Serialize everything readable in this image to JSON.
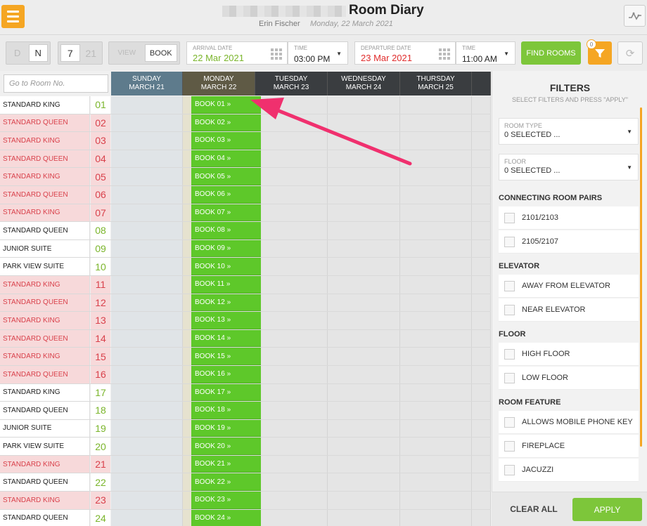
{
  "header": {
    "title": "Room Diary",
    "user": "Erin Fischer",
    "date": "Monday, 22 March 2021"
  },
  "toolbar": {
    "day_toggle": [
      "D",
      "N"
    ],
    "num_toggle": [
      "7",
      "21"
    ],
    "mode_toggle": [
      "VIEW",
      "BOOK"
    ],
    "arrival_label": "ARRIVAL DATE",
    "arrival_value": "22 Mar 2021",
    "arrival_time_label": "TIME",
    "arrival_time": "03:00 PM",
    "departure_label": "DEPARTURE DATE",
    "departure_value": "23 Mar 2021",
    "departure_time_label": "TIME",
    "departure_time": "11:00 AM",
    "find_rooms": "FIND ROOMS",
    "filter_badge": "0"
  },
  "grid": {
    "search_placeholder": "Go to Room No.",
    "days": [
      {
        "dow": "SUNDAY",
        "date": "MARCH 21"
      },
      {
        "dow": "MONDAY",
        "date": "MARCH 22"
      },
      {
        "dow": "TUESDAY",
        "date": "MARCH 23"
      },
      {
        "dow": "WEDNESDAY",
        "date": "MARCH 24"
      },
      {
        "dow": "THURSDAY",
        "date": "MARCH 25"
      }
    ],
    "rooms": [
      {
        "type": "STANDARD KING",
        "num": "01",
        "book": "BOOK 01 »",
        "dirty": false
      },
      {
        "type": "STANDARD QUEEN",
        "num": "02",
        "book": "BOOK 02 »",
        "dirty": true
      },
      {
        "type": "STANDARD KING",
        "num": "03",
        "book": "BOOK 03 »",
        "dirty": true
      },
      {
        "type": "STANDARD QUEEN",
        "num": "04",
        "book": "BOOK 04 »",
        "dirty": true
      },
      {
        "type": "STANDARD KING",
        "num": "05",
        "book": "BOOK 05 »",
        "dirty": true
      },
      {
        "type": "STANDARD QUEEN",
        "num": "06",
        "book": "BOOK 06 »",
        "dirty": true
      },
      {
        "type": "STANDARD KING",
        "num": "07",
        "book": "BOOK 07 »",
        "dirty": true
      },
      {
        "type": "STANDARD QUEEN",
        "num": "08",
        "book": "BOOK 08 »",
        "dirty": false
      },
      {
        "type": "JUNIOR SUITE",
        "num": "09",
        "book": "BOOK 09 »",
        "dirty": false
      },
      {
        "type": "PARK VIEW SUITE",
        "num": "10",
        "book": "BOOK 10 »",
        "dirty": false
      },
      {
        "type": "STANDARD KING",
        "num": "11",
        "book": "BOOK 11 »",
        "dirty": true
      },
      {
        "type": "STANDARD QUEEN",
        "num": "12",
        "book": "BOOK 12 »",
        "dirty": true
      },
      {
        "type": "STANDARD KING",
        "num": "13",
        "book": "BOOK 13 »",
        "dirty": true
      },
      {
        "type": "STANDARD QUEEN",
        "num": "14",
        "book": "BOOK 14 »",
        "dirty": true
      },
      {
        "type": "STANDARD KING",
        "num": "15",
        "book": "BOOK 15 »",
        "dirty": true
      },
      {
        "type": "STANDARD QUEEN",
        "num": "16",
        "book": "BOOK 16 »",
        "dirty": true
      },
      {
        "type": "STANDARD KING",
        "num": "17",
        "book": "BOOK 17 »",
        "dirty": false
      },
      {
        "type": "STANDARD QUEEN",
        "num": "18",
        "book": "BOOK 18 »",
        "dirty": false
      },
      {
        "type": "JUNIOR SUITE",
        "num": "19",
        "book": "BOOK 19 »",
        "dirty": false
      },
      {
        "type": "PARK VIEW SUITE",
        "num": "20",
        "book": "BOOK 20 »",
        "dirty": false
      },
      {
        "type": "STANDARD KING",
        "num": "21",
        "book": "BOOK 21 »",
        "dirty": true
      },
      {
        "type": "STANDARD QUEEN",
        "num": "22",
        "book": "BOOK 22 »",
        "dirty": false
      },
      {
        "type": "STANDARD KING",
        "num": "23",
        "book": "BOOK 23 »",
        "dirty": true
      },
      {
        "type": "STANDARD QUEEN",
        "num": "24",
        "book": "BOOK 24 »",
        "dirty": false
      }
    ]
  },
  "filters": {
    "title": "FILTERS",
    "subtitle": "SELECT FILTERS AND PRESS \"APPLY\"",
    "room_type_label": "ROOM TYPE",
    "room_type_value": "0 SELECTED ...",
    "floor_label": "FLOOR",
    "floor_value": "0 SELECTED ...",
    "sections": [
      {
        "title": "CONNECTING ROOM PAIRS",
        "options": [
          "2101/2103",
          "2105/2107"
        ]
      },
      {
        "title": "ELEVATOR",
        "options": [
          "AWAY FROM ELEVATOR",
          "NEAR ELEVATOR"
        ]
      },
      {
        "title": "FLOOR",
        "options": [
          "HIGH FLOOR",
          "LOW FLOOR"
        ]
      },
      {
        "title": "ROOM FEATURE",
        "options": [
          "ALLOWS MOBILE PHONE KEY",
          "FIREPLACE",
          "JACUZZI"
        ]
      }
    ],
    "clear_all": "CLEAR ALL",
    "apply": "APPLY"
  },
  "colors": {
    "accent_orange": "#f5a623",
    "book_green": "#5ec82a",
    "button_green": "#7dc63a",
    "dirty_red": "#d9414b",
    "annotation_arrow": "#f0306e"
  }
}
